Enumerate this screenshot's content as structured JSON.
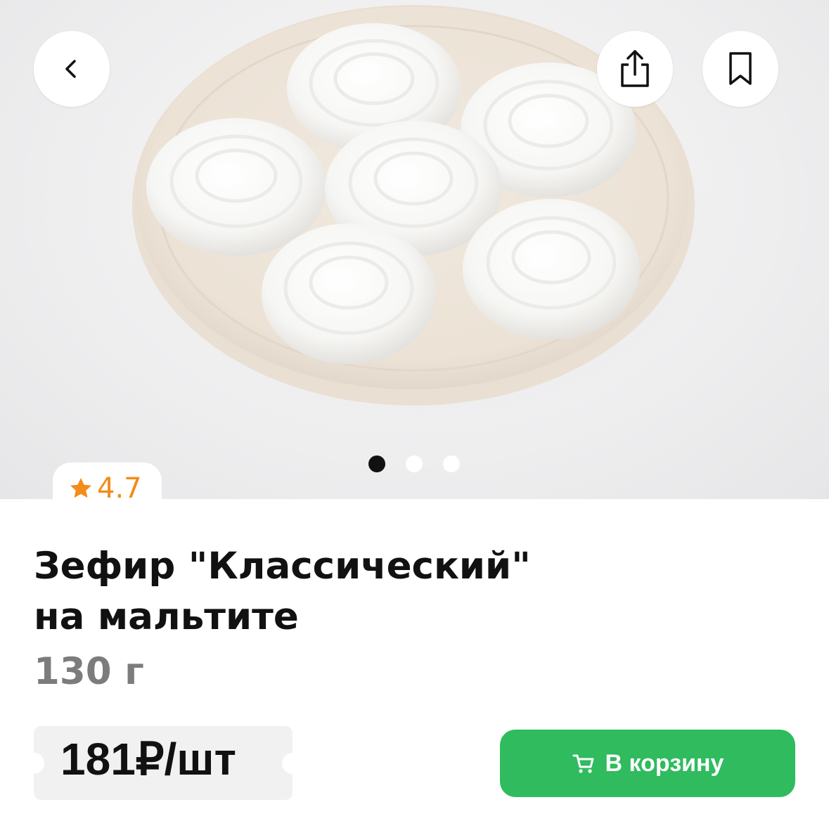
{
  "product": {
    "title_line1": "Зефир \"Классический\"",
    "title_line2": "на мальтите",
    "weight": "130 г",
    "rating": "4.7",
    "price": "181₽/шт"
  },
  "actions": {
    "add_to_cart": "В корзину"
  },
  "gallery": {
    "total_images": 3,
    "active_index": 0
  },
  "colors": {
    "accent_green": "#2fbb5e",
    "rating_orange": "#f28c1a"
  },
  "icons": {
    "back": "chevron-left-icon",
    "share": "share-icon",
    "bookmark": "bookmark-icon",
    "star": "star-icon",
    "cart": "cart-icon"
  }
}
